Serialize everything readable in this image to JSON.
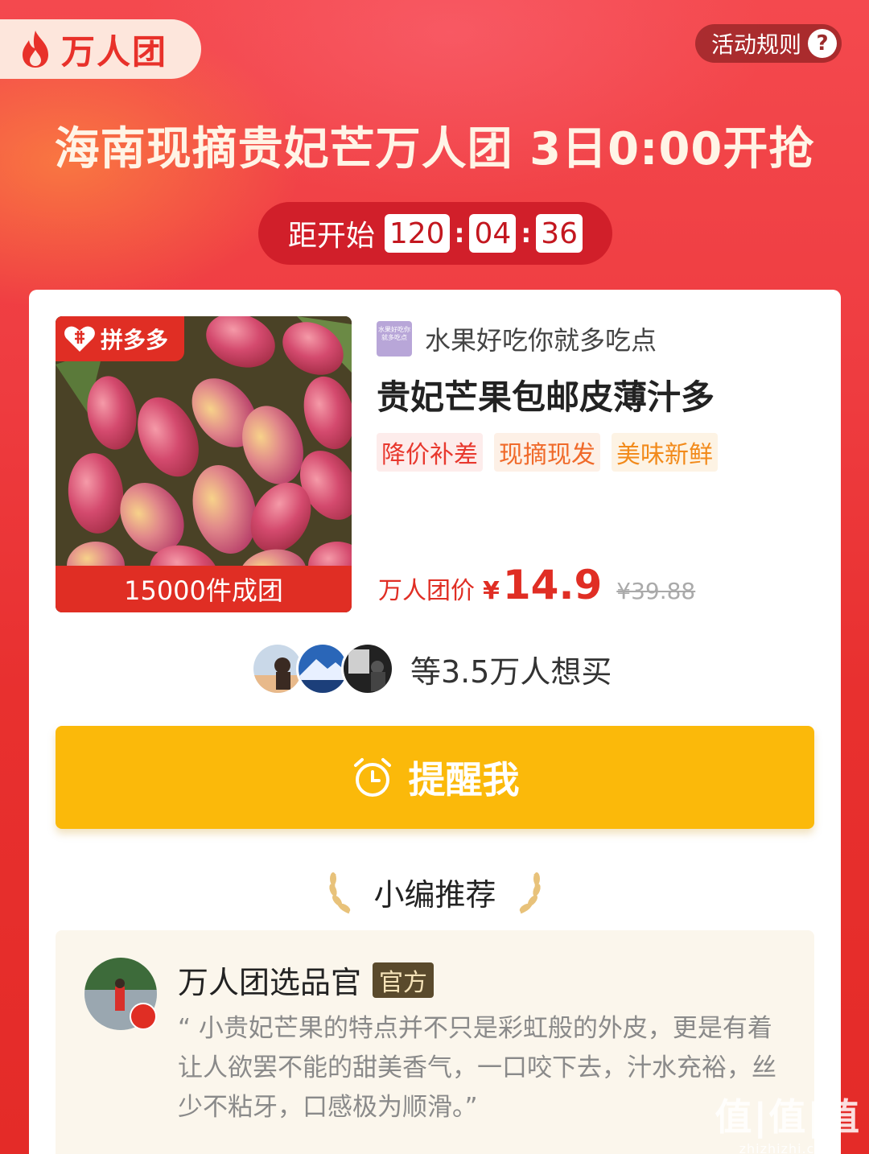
{
  "header": {
    "brand_label": "万人团",
    "rules_label": "活动规则",
    "rules_icon": "?",
    "headline": "海南现摘贵妃芒万人团 3日0:00开抢"
  },
  "countdown": {
    "label": "距开始",
    "hours": "120",
    "minutes": "04",
    "seconds": "36",
    "separator": ":"
  },
  "product": {
    "platform_tag": "拼多多",
    "group_size_label": "15000件成团",
    "store_name": "水果好吃你就多吃点",
    "store_logo_text": "水果好吃你就多吃点",
    "title": "贵妃芒果包邮皮薄汁多",
    "tags": [
      "降价补差",
      "现摘现发",
      "美味新鲜"
    ],
    "price_label": "万人团价",
    "currency": "¥",
    "price": "14.9",
    "original_price": "¥39.88"
  },
  "buyers": {
    "text": "等3.5万人想买"
  },
  "remind_button": {
    "label": "提醒我"
  },
  "editor": {
    "section_title": "小编推荐",
    "name": "万人团选品官",
    "badge": "官方",
    "quote": "“ 小贵妃芒果的特点并不只是彩虹般的外皮，更是有着让人欲罢不能的甜美香气，一口咬下去，汁水充裕，丝少不粘牙，口感极为顺滑。”"
  },
  "watermark": {
    "main": "值|值|值",
    "sub": "zhizhizhi.com"
  },
  "colors": {
    "brand_red": "#e02e24",
    "button_yellow": "#fbb90a",
    "background": "#e83a36"
  }
}
